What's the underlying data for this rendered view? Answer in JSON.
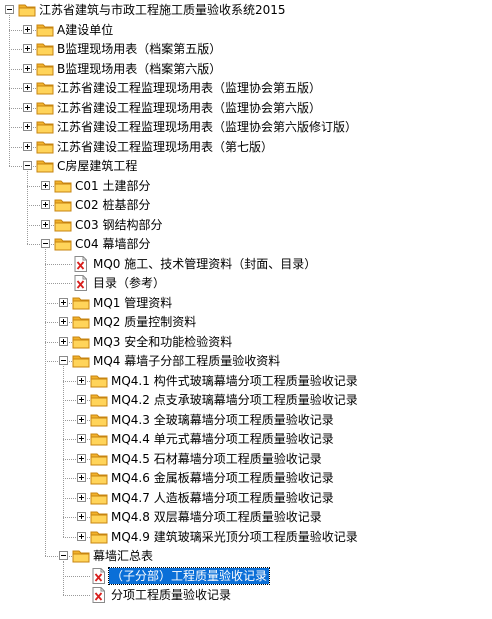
{
  "tree": {
    "root": "江苏省建筑与市政工程施工质量验收系统2015",
    "items": [
      "A建设单位",
      "B监理现场用表（档案第五版）",
      "B监理现场用表（档案第六版）",
      "江苏省建设工程监理现场用表（监理协会第五版）",
      "江苏省建设工程监理现场用表（监理协会第六版）",
      "江苏省建设工程监理现场用表（监理协会第六版修订版）",
      "江苏省建设工程监理现场用表（第七版）",
      "C房屋建筑工程",
      "C01 土建部分",
      "C02 桩基部分",
      "C03 钢结构部分",
      "C04 幕墙部分",
      "MQ0 施工、技术管理资料（封面、目录）",
      "目录（参考）",
      "MQ1 管理资料",
      "MQ2 质量控制资料",
      "MQ3 安全和功能检验资料",
      "MQ4 幕墙子分部工程质量验收资料",
      "MQ4.1 构件式玻璃幕墙分项工程质量验收记录",
      "MQ4.2 点支承玻璃幕墙分项工程质量验收记录",
      "MQ4.3 全玻璃幕墙分项工程质量验收记录",
      "MQ4.4 单元式幕墙分项工程质量验收记录",
      "MQ4.5 石材幕墙分项工程质量验收记录",
      "MQ4.6 金属板幕墙分项工程质量验收记录",
      "MQ4.7 人造板幕墙分项工程质量验收记录",
      "MQ4.8 双层幕墙分项工程质量验收记录",
      "MQ4.9 建筑玻璃采光顶分项工程质量验收记录",
      "幕墙汇总表",
      "（子分部）工程质量验收记录",
      "分项工程质量验收记录"
    ]
  }
}
